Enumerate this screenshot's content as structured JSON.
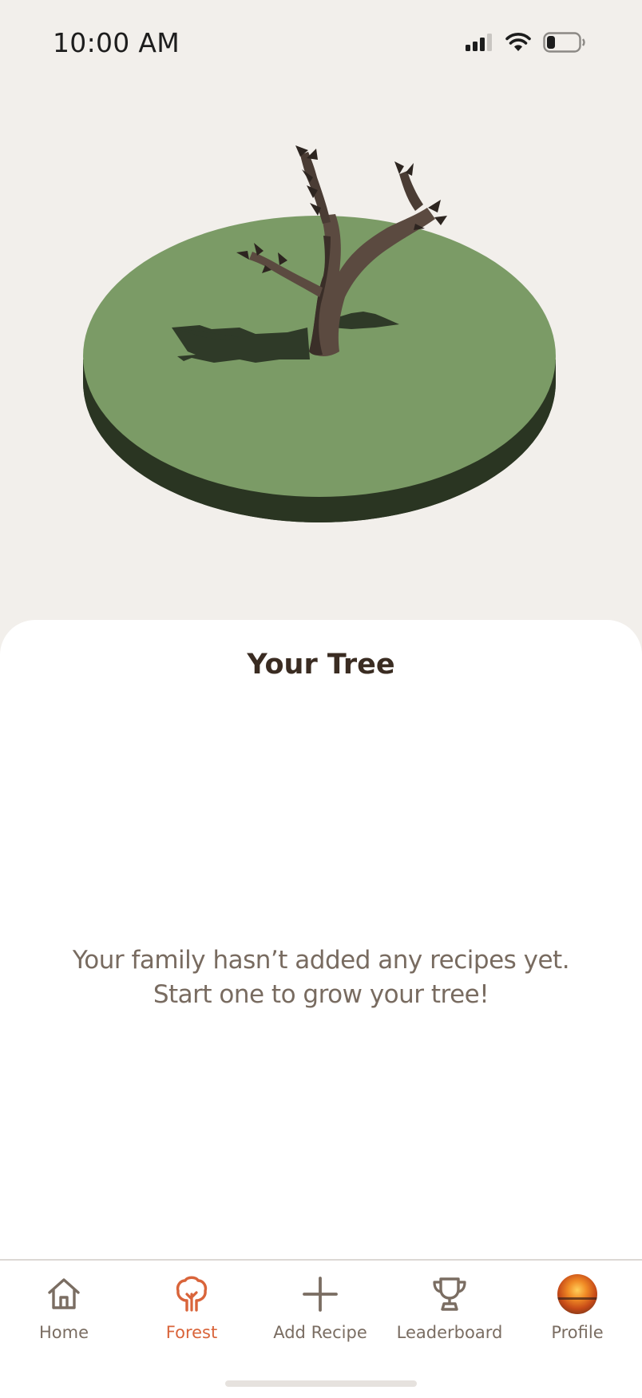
{
  "status_bar": {
    "time": "10:00 AM",
    "icons": [
      "cellular-signal-icon",
      "wifi-icon",
      "battery-icon"
    ]
  },
  "hero": {
    "scene": "tree-on-grass-disc",
    "colors": {
      "grass": "#7b9b66",
      "grass_edge": "#2a3522",
      "trunk": "#5b4a40"
    }
  },
  "sheet": {
    "title": "Your Tree",
    "empty_message_line1": "Your family hasn’t added any recipes yet.",
    "empty_message_line2": "Start one to grow your tree!"
  },
  "tabbar": {
    "active_color": "#d9643a",
    "inactive_color": "#7a6d62",
    "tabs": [
      {
        "label": "Home",
        "icon": "home-icon",
        "active": false
      },
      {
        "label": "Forest",
        "icon": "tree-icon",
        "active": true
      },
      {
        "label": "Add Recipe",
        "icon": "plus-icon",
        "active": false
      },
      {
        "label": "Leaderboard",
        "icon": "trophy-icon",
        "active": false
      },
      {
        "label": "Profile",
        "icon": "avatar",
        "active": false
      }
    ]
  }
}
